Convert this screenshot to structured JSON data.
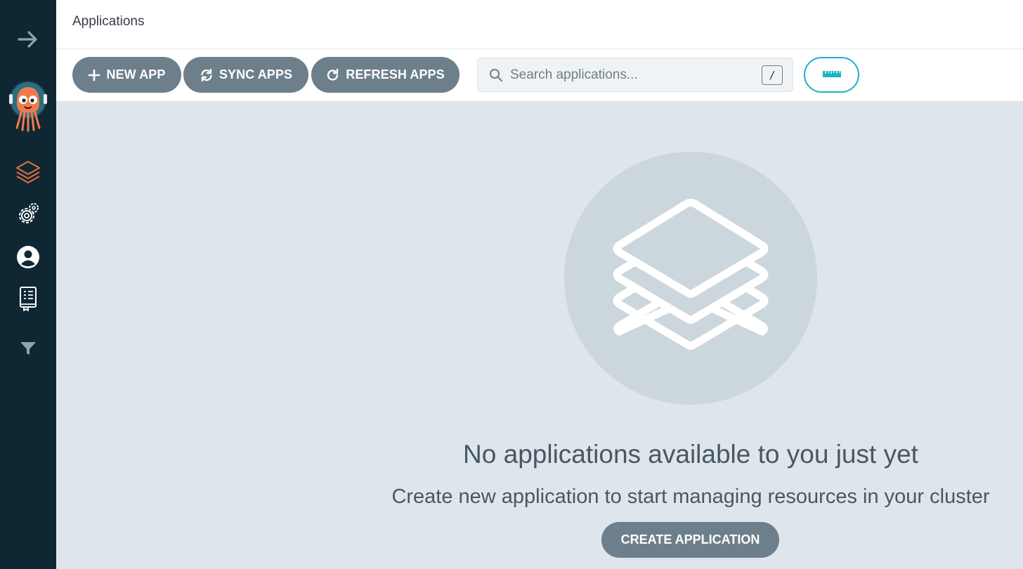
{
  "header": {
    "title": "Applications"
  },
  "sidebar": {
    "items": [
      {
        "name": "expand",
        "icon": "arrow-right-icon"
      },
      {
        "name": "logo",
        "icon": "argo-logo-icon"
      },
      {
        "name": "applications",
        "icon": "layers-icon",
        "active": true
      },
      {
        "name": "settings",
        "icon": "gears-icon"
      },
      {
        "name": "user-info",
        "icon": "user-circle-icon"
      },
      {
        "name": "docs",
        "icon": "book-icon"
      },
      {
        "name": "filter",
        "icon": "filter-icon"
      }
    ]
  },
  "toolbar": {
    "new_app_label": "NEW APP",
    "sync_apps_label": "SYNC APPS",
    "refresh_apps_label": "REFRESH APPS",
    "search_placeholder": "Search applications...",
    "search_value": "",
    "search_shortcut": "/",
    "view_toggle_icon": "ruler-icon"
  },
  "empty_state": {
    "icon": "layers-icon",
    "title": "No applications available to you just yet",
    "subtitle": "Create new application to start managing resources in your cluster",
    "create_label": "CREATE APPLICATION"
  },
  "colors": {
    "sidebar_bg": "#0f2733",
    "accent_orange": "#e96d40",
    "button_bg": "#6d7f8b",
    "teal": "#18b4c7",
    "content_bg": "#dee6eb"
  }
}
